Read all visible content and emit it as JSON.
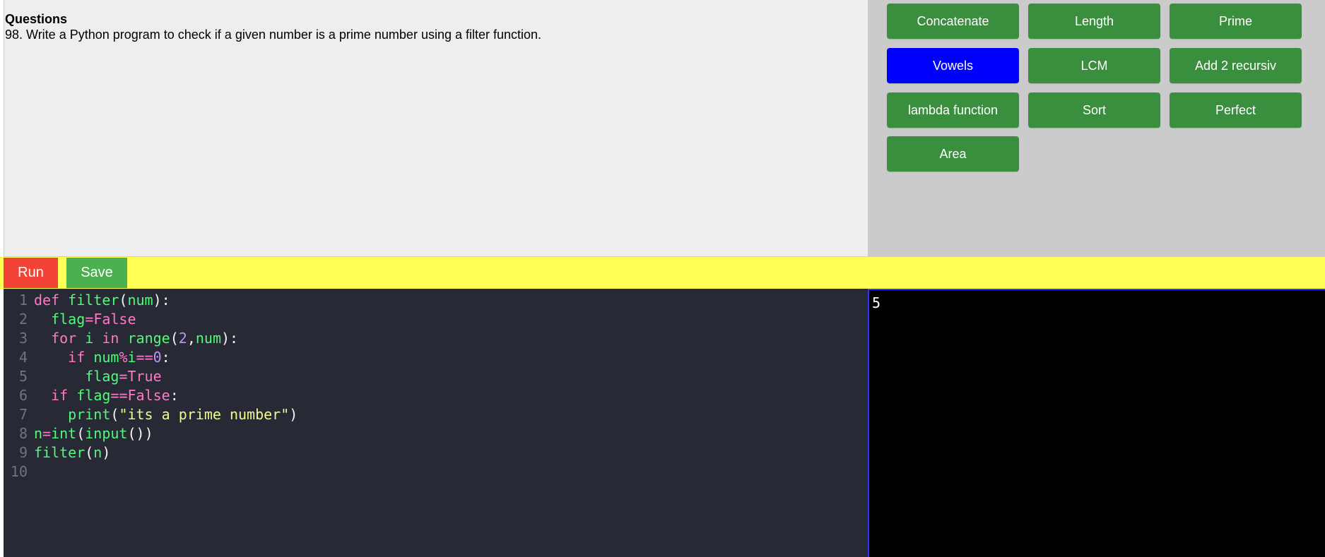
{
  "question": {
    "heading": "Questions",
    "text": "98. Write a Python program to check if a given number is a prime number using a filter function."
  },
  "question_buttons": [
    {
      "label": "Concatenate",
      "active": false
    },
    {
      "label": "Length",
      "active": false
    },
    {
      "label": "Prime",
      "active": false
    },
    {
      "label": "Vowels",
      "active": true
    },
    {
      "label": "LCM",
      "active": false
    },
    {
      "label": "Add 2 recursiv",
      "active": false
    },
    {
      "label": "lambda function",
      "active": false
    },
    {
      "label": "Sort",
      "active": false
    },
    {
      "label": "Perfect",
      "active": false
    },
    {
      "label": "Area",
      "active": false
    }
  ],
  "toolbar": {
    "run_label": "Run",
    "save_label": "Save"
  },
  "editor": {
    "lines": [
      "def filter(num):",
      "  flag=False",
      "  for i in range(2,num):",
      "    if num%i==0:",
      "      flag=True",
      "  if flag==False:",
      "    print(\"its a prime number\")",
      "n=int(input())",
      "filter(n)",
      ""
    ]
  },
  "console": {
    "output": "5"
  },
  "colors": {
    "green_button": "#3a8f3e",
    "active_button": "#0000ff",
    "run_button": "#f44336",
    "save_button": "#4caf50",
    "toolbar_bg": "#ffff55",
    "editor_bg": "#272935",
    "console_bg": "#000000"
  }
}
